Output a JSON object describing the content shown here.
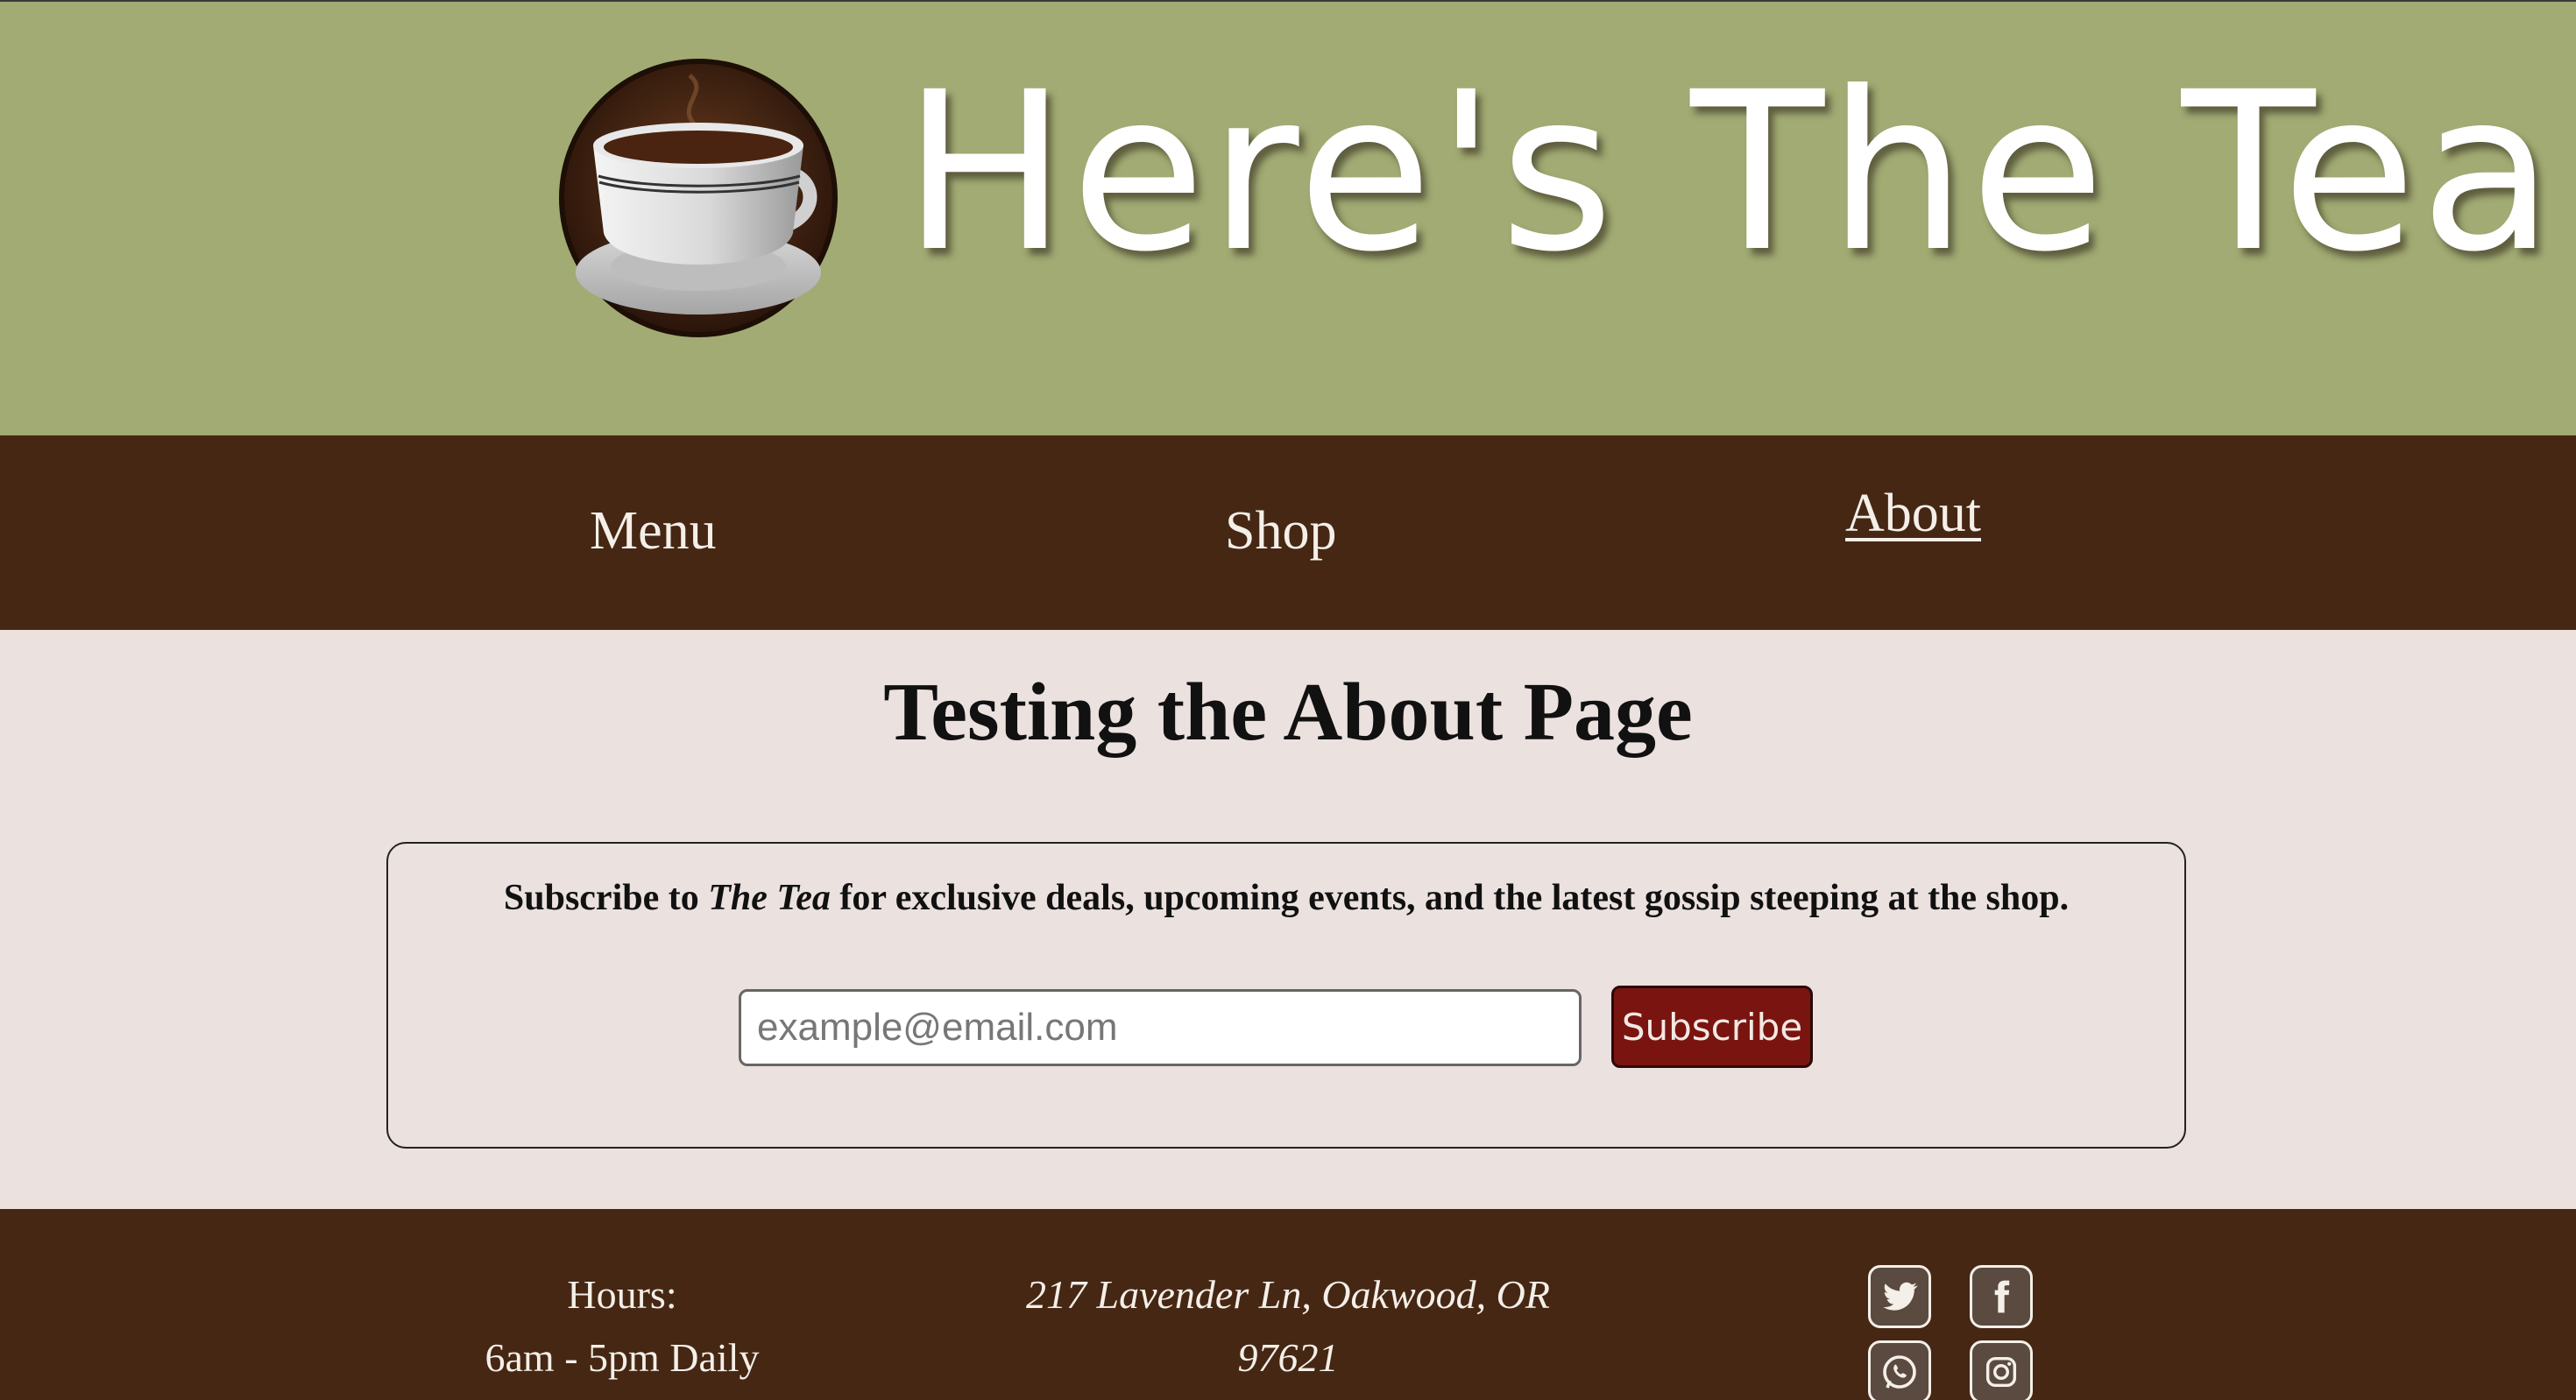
{
  "header": {
    "site_title": "Here's The Tea",
    "logo_icon": "teacup-logo-icon"
  },
  "nav": {
    "items": [
      {
        "label": "Menu",
        "active": false
      },
      {
        "label": "Shop",
        "active": false
      },
      {
        "label": "About",
        "active": true
      }
    ]
  },
  "main": {
    "page_title": "Testing the About Page",
    "subscribe": {
      "text_before": "Subscribe to ",
      "text_italic": "The Tea",
      "text_after": " for exclusive deals, upcoming events, and the latest gossip steeping at the shop.",
      "email_placeholder": "example@email.com",
      "button_label": "Subscribe"
    }
  },
  "footer": {
    "hours_label": "Hours:",
    "hours_value": "6am - 5pm Daily",
    "address_line1": "217 Lavender Ln, Oakwood, OR",
    "address_line2": "97621",
    "social_icons": [
      "twitter-icon",
      "facebook-icon",
      "whatsapp-icon",
      "instagram-icon"
    ]
  },
  "colors": {
    "banner_bg": "#a1ab73",
    "nav_bg": "#452714",
    "page_bg": "#ebe1df",
    "button_bg": "#7a1410"
  }
}
